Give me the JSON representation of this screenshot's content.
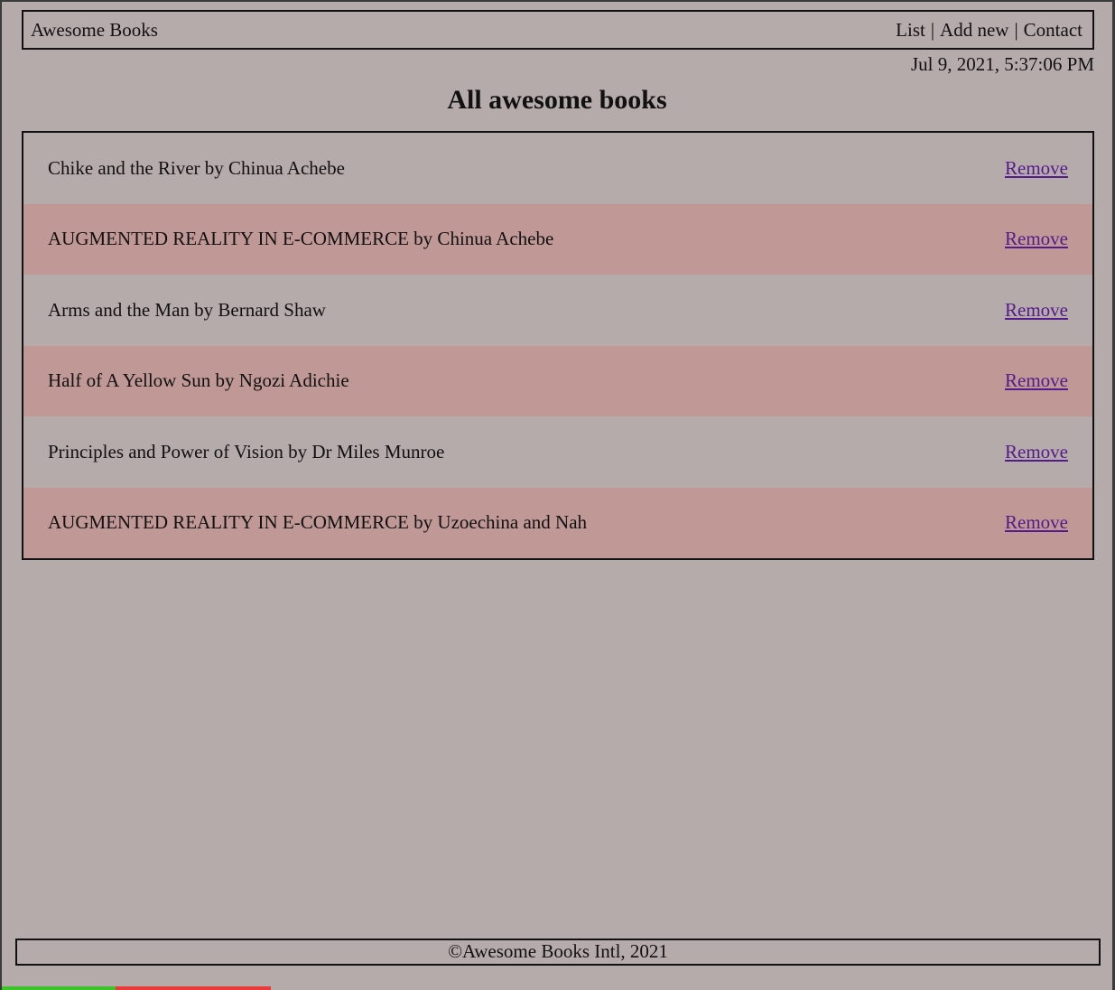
{
  "header": {
    "brand": "Awesome Books",
    "nav": {
      "list": "List",
      "add_new": "Add new",
      "contact": "Contact",
      "separator": "|"
    }
  },
  "datetime": "Jul 9, 2021, 5:37:06 PM",
  "page_title": "All awesome books",
  "books": [
    {
      "text": "Chike and the River by Chinua Achebe",
      "action": "Remove"
    },
    {
      "text": "AUGMENTED REALITY IN E-COMMERCE by Chinua Achebe",
      "action": "Remove"
    },
    {
      "text": "Arms and the Man by Bernard Shaw",
      "action": "Remove"
    },
    {
      "text": "Half of A Yellow Sun by Ngozi Adichie",
      "action": "Remove"
    },
    {
      "text": "Principles and Power of Vision by Dr Miles Munroe",
      "action": "Remove"
    },
    {
      "text": "AUGMENTED REALITY IN E-COMMERCE by Uzoechina and Nah",
      "action": "Remove"
    }
  ],
  "footer": {
    "text": "©Awesome Books Intl, 2021"
  },
  "colors": {
    "background": "#b5abaa",
    "alt_row": "#c09896",
    "link": "#551a8b"
  }
}
